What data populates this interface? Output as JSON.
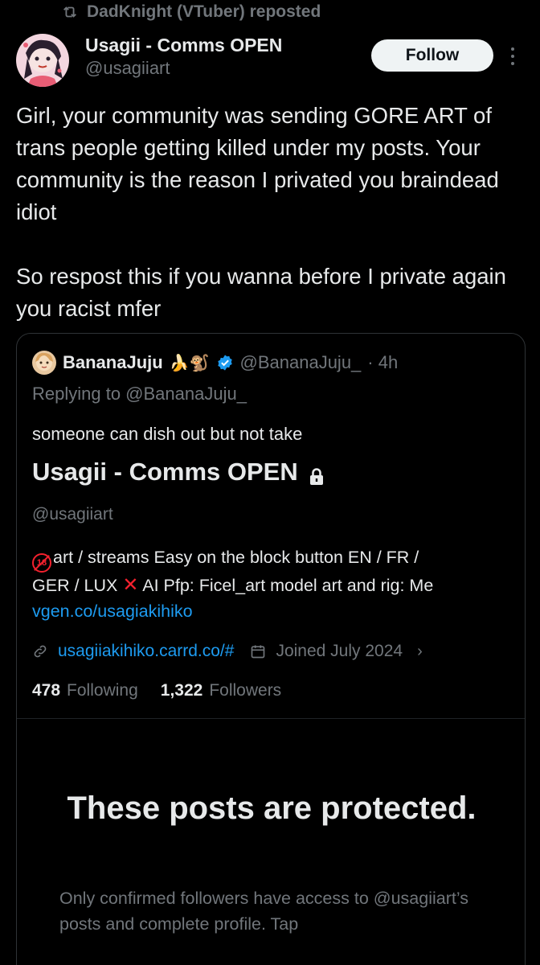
{
  "repost": {
    "label": "DadKnight (VTuber) reposted"
  },
  "author": {
    "name": "Usagii - Comms OPEN",
    "handle": "@usagiiart"
  },
  "actions": {
    "follow_label": "Follow"
  },
  "post": {
    "paragraph1": "Girl, your community was sending GORE ART of trans people getting killed under my posts. Your community is the reason I privated you braindead idiot",
    "paragraph2": "So respost this if you wanna before I private again you racist mfer"
  },
  "quote": {
    "name": "BananaJuju",
    "emojis": "🍌🐒",
    "handle": "@BananaJuju_",
    "time": "· 4h",
    "replying_to": "Replying to @BananaJuju_",
    "text": "someone can dish out but not take",
    "profile": {
      "name": "Usagii - Comms OPEN",
      "handle": "@usagiiart",
      "bio_line1": "art  / streams  Easy on the block button EN / FR /",
      "bio_line2a": "GER / LUX",
      "bio_line2b": " AI Pfp: Ficel_art model art and rig: Me",
      "bio_link": "vgen.co/usagiakihiko",
      "website": "usagiiakihiko.carrd.co/#",
      "joined": "Joined July 2024",
      "following_count": "478",
      "following_label": "Following",
      "followers_count": "1,322",
      "followers_label": "Followers",
      "protected_title": "These posts are protected.",
      "protected_desc": "Only confirmed followers have access to @usagiiart’s posts and complete profile. Tap"
    }
  },
  "colors": {
    "background": "#000000",
    "text": "#e7e9ea",
    "muted": "#71767b",
    "link": "#1d9bf0",
    "border": "#2f3336"
  }
}
